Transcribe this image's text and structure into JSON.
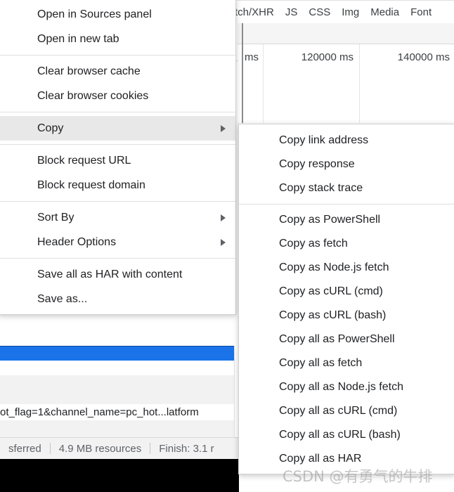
{
  "devtools": {
    "filter_tabs": [
      "tch/XHR",
      "JS",
      "CSS",
      "Img",
      "Media",
      "Font"
    ],
    "timeline": {
      "unit_label": "ms",
      "ticks": [
        "120000 ms",
        "140000 ms"
      ]
    },
    "request_url": "ot_flag=1&channel_name=pc_hot...latform",
    "status_bar": {
      "transferred": "sferred",
      "resources": "4.9 MB resources",
      "finish": "Finish: 3.1 r"
    },
    "colors": {
      "selected_row": "#1a73e8",
      "menu_highlight": "#e8e8e8"
    }
  },
  "context_menu": {
    "groups": [
      {
        "items": [
          {
            "label": "Open in Sources panel",
            "submenu": false,
            "highlighted": false
          },
          {
            "label": "Open in new tab",
            "submenu": false,
            "highlighted": false
          }
        ]
      },
      {
        "items": [
          {
            "label": "Clear browser cache",
            "submenu": false,
            "highlighted": false
          },
          {
            "label": "Clear browser cookies",
            "submenu": false,
            "highlighted": false
          }
        ]
      },
      {
        "items": [
          {
            "label": "Copy",
            "submenu": true,
            "highlighted": true
          }
        ]
      },
      {
        "items": [
          {
            "label": "Block request URL",
            "submenu": false,
            "highlighted": false
          },
          {
            "label": "Block request domain",
            "submenu": false,
            "highlighted": false
          }
        ]
      },
      {
        "items": [
          {
            "label": "Sort By",
            "submenu": true,
            "highlighted": false
          },
          {
            "label": "Header Options",
            "submenu": true,
            "highlighted": false
          }
        ]
      },
      {
        "items": [
          {
            "label": "Save all as HAR with content",
            "submenu": false,
            "highlighted": false
          },
          {
            "label": "Save as...",
            "submenu": false,
            "highlighted": false
          }
        ]
      }
    ]
  },
  "copy_submenu": {
    "groups": [
      {
        "items": [
          {
            "label": "Copy link address"
          },
          {
            "label": "Copy response"
          },
          {
            "label": "Copy stack trace"
          }
        ]
      },
      {
        "items": [
          {
            "label": "Copy as PowerShell"
          },
          {
            "label": "Copy as fetch"
          },
          {
            "label": "Copy as Node.js fetch"
          },
          {
            "label": "Copy as cURL (cmd)"
          },
          {
            "label": "Copy as cURL (bash)"
          },
          {
            "label": "Copy all as PowerShell"
          },
          {
            "label": "Copy all as fetch"
          },
          {
            "label": "Copy all as Node.js fetch"
          },
          {
            "label": "Copy all as cURL (cmd)"
          },
          {
            "label": "Copy all as cURL (bash)"
          },
          {
            "label": "Copy all as HAR"
          }
        ]
      }
    ]
  },
  "watermark": {
    "text": "CSDN @有勇气的牛排"
  }
}
